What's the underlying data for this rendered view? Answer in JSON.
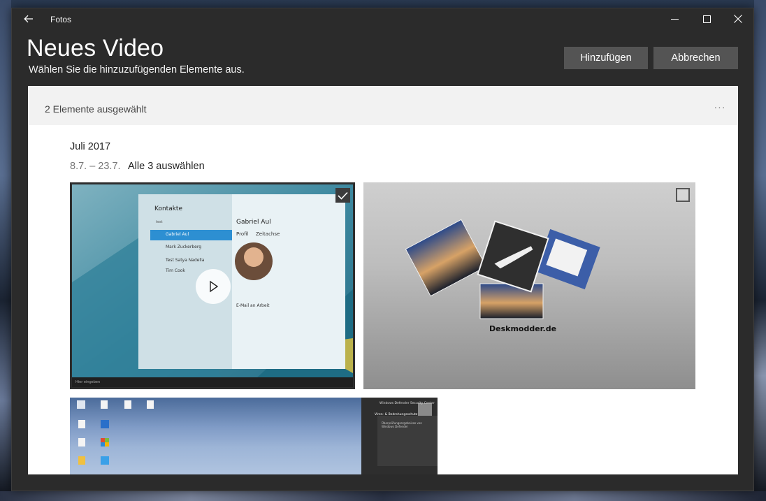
{
  "window": {
    "app_title": "Fotos"
  },
  "header": {
    "title": "Neues Video",
    "subtitle": "Wählen Sie die hinzuzufügenden Elemente aus.",
    "add_label": "Hinzufügen",
    "cancel_label": "Abbrechen"
  },
  "selection": {
    "count_text": "2 Elemente ausgewählt",
    "more_label": "···"
  },
  "group": {
    "month": "Juli 2017",
    "range": "8.7. – 23.7.",
    "select_all": "Alle 3 auswählen"
  },
  "tiles": [
    {
      "kind": "video",
      "selected": true,
      "preview": {
        "app_name": "Kontakte",
        "search": "test",
        "contacts": [
          "Gabriel Aul",
          "Mark Zuckerberg",
          "Test Satya Nadella",
          "Tim Cook"
        ],
        "contact_name": "Gabriel Aul",
        "tab_profile": "Profil",
        "tab_timeline": "Zeitachse",
        "email_label": "E-Mail an Arbeit",
        "taskbar_search": "Hier eingeben"
      }
    },
    {
      "kind": "photo",
      "selected": false,
      "caption": "Deskmodder.de"
    },
    {
      "kind": "photo",
      "selected": false,
      "preview": {
        "notice_title": "Windows Defender Security Center",
        "notice_heading": "Viren- & Bedrohungsschutz",
        "notice_body": "Überprüfungsergebnisse von Windows Defender"
      }
    }
  ],
  "colors": {
    "window_bg": "#2b2b2b",
    "button_bg": "#545454",
    "selbar_bg": "#f2f2f2",
    "content_bg": "#ffffff"
  },
  "icons": [
    "back-arrow-icon",
    "minimize-icon",
    "maximize-icon",
    "close-icon",
    "play-icon",
    "checkmark-icon",
    "more-icon"
  ]
}
